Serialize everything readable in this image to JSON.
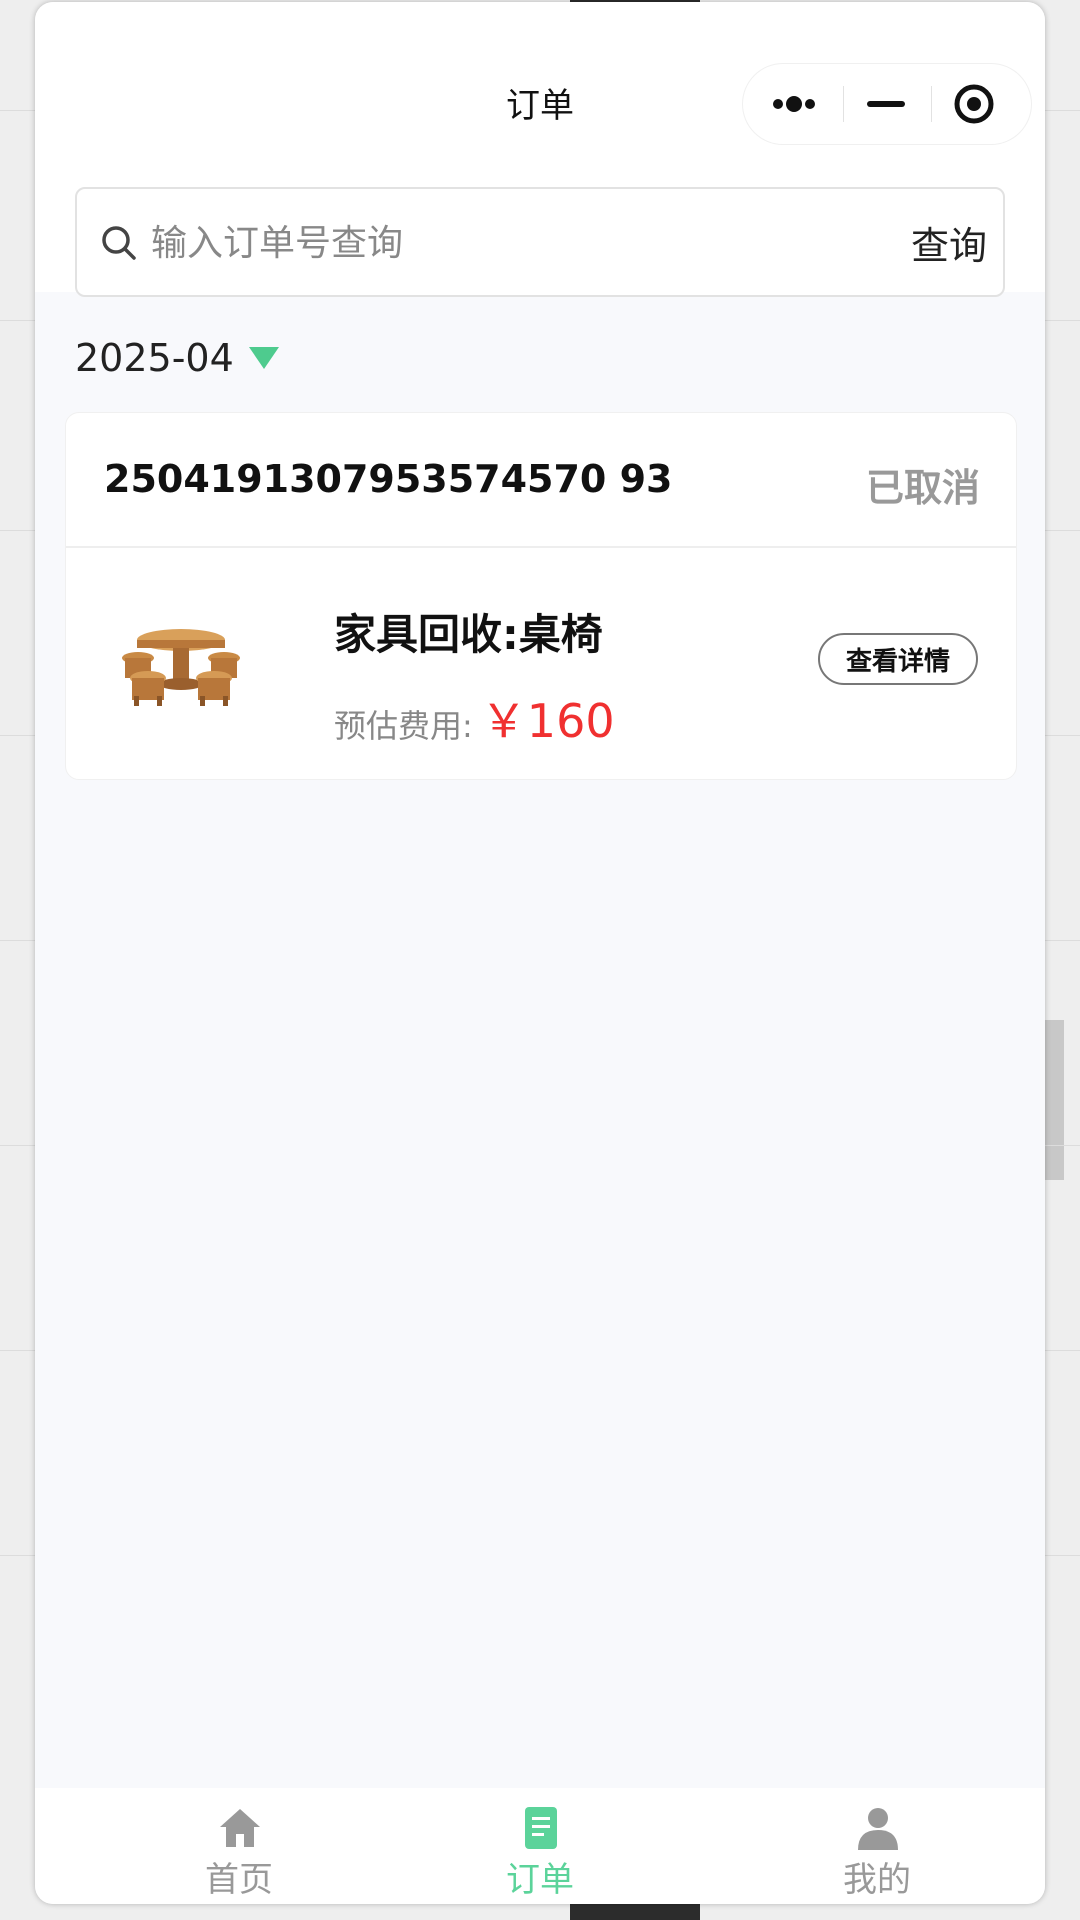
{
  "header": {
    "title": "订单",
    "capsule": {
      "more_icon": "more-dots-icon",
      "minimize_icon": "minimize-icon",
      "close_icon": "target-close-icon"
    }
  },
  "search": {
    "placeholder": "输入订单号查询",
    "button_label": "查询",
    "icon": "search-icon"
  },
  "filter": {
    "month": "2025-04",
    "caret_color": "#4ecb8e"
  },
  "orders": [
    {
      "order_no": "2504191307953574570 93",
      "status": "已取消",
      "item_name": "家具回收:桌椅",
      "fee_label": "预估费用:",
      "fee_amount": "￥160",
      "detail_button": "查看详情",
      "thumbnail": "table-chairs-image"
    }
  ],
  "tabbar": {
    "active_color": "#5bd39a",
    "items": [
      {
        "label": "首页",
        "icon": "home-icon",
        "active": false
      },
      {
        "label": "订单",
        "icon": "order-doc-icon",
        "active": true
      },
      {
        "label": "我的",
        "icon": "user-icon",
        "active": false
      }
    ]
  }
}
